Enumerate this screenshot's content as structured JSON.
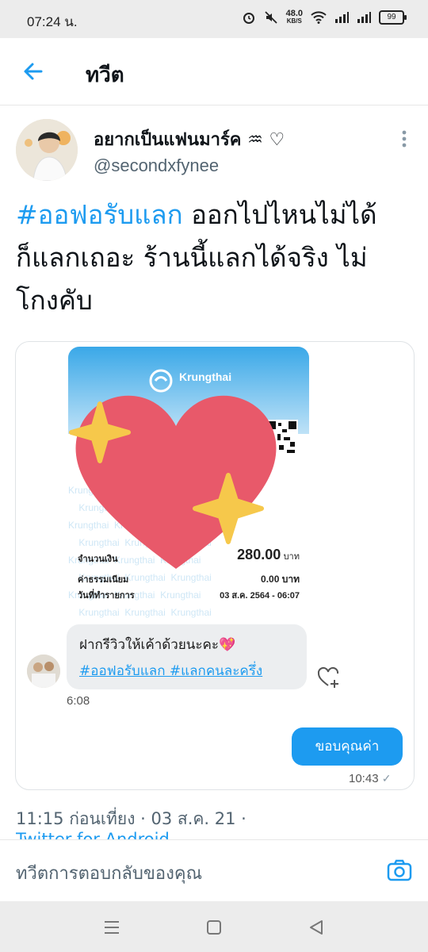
{
  "status_bar": {
    "time": "07:24 น.",
    "net_speed": "48.0",
    "net_unit": "KB/S",
    "battery": "99"
  },
  "app_bar": {
    "title": "ทวีต"
  },
  "tweet": {
    "display_name": "อยากเป็นแฟนมาร์ค ♒ ♡",
    "handle": "@secondxfynee",
    "text_hashtag": "#ออฟอรับแลก",
    "text_line1_rest": " ออกไปไหนไม่ได้",
    "text_line2": "ก็แลกเถอะ ร้านนี้แลกได้จริง ไม่",
    "text_line3": "โกงคับ",
    "timestamp": "11:15 ก่อนเที่ยง · 03 ส.ค. 21 ·",
    "source": "Twitter for Android"
  },
  "media": {
    "receipt": {
      "bank": "Krungthai",
      "watermark": "Krungthai",
      "amount_label": "จำนวนเงิน",
      "amount_value": "280.00",
      "amount_unit": "บาท",
      "fee_label": "ค่าธรรมเนียม",
      "fee_value": "0.00 บาท",
      "date_label": "วันที่ทำรายการ",
      "date_value": "03 ส.ค. 2564 - 06:07"
    },
    "chat": {
      "incoming_text": "ฝากรีวิวให้เค้าด้วยนะคะ💖",
      "incoming_tags": "#ออฟอรับแลก #แลกคนละครึ่ง",
      "incoming_time": "6:08",
      "outgoing_text": "ขอบคุณค่า",
      "outgoing_time": "10:43",
      "check": "✓"
    }
  },
  "reply": {
    "placeholder": "ทวีตการตอบกลับของคุณ"
  },
  "colors": {
    "accent": "#1d9bf0",
    "heart": "#e8596a",
    "sparkle": "#f6c84b"
  },
  "icons": [
    "back-arrow-icon",
    "more-vertical-icon",
    "camera-icon",
    "heart-add-icon",
    "sparkling-heart-sticker",
    "menu-icon",
    "home-icon",
    "back-icon"
  ]
}
